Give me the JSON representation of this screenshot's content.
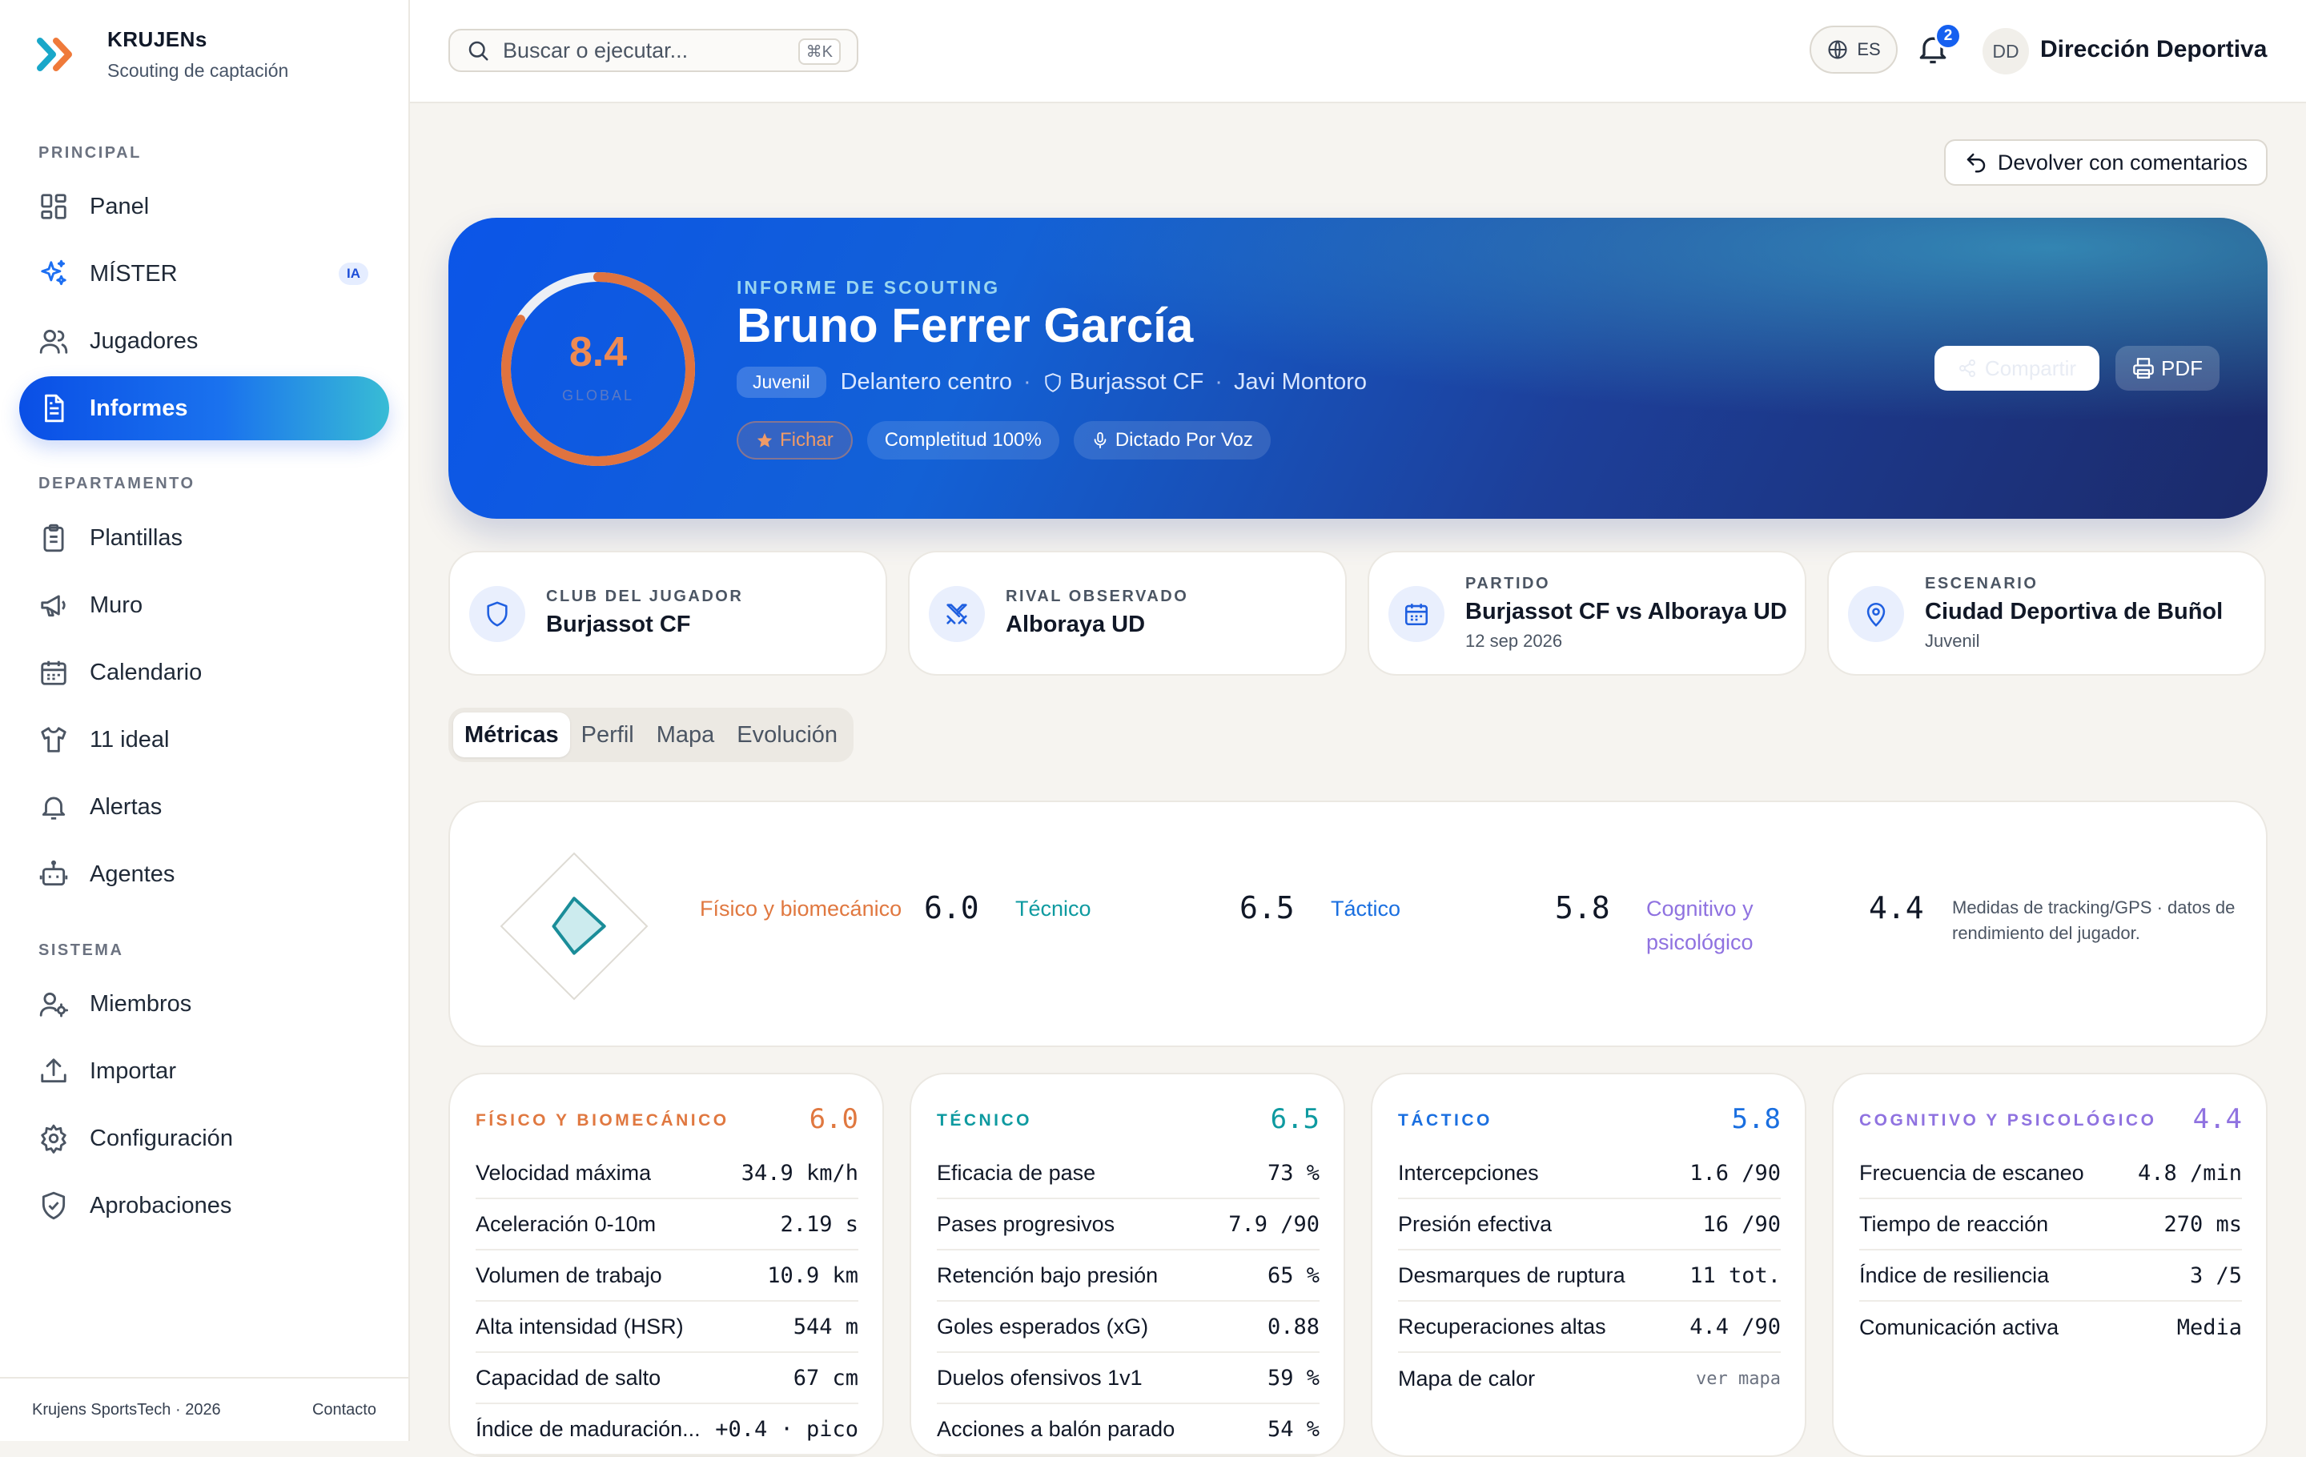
{
  "app": {
    "name": "KRUJENs",
    "subtitle": "Scouting de captación"
  },
  "sidebar": {
    "sections": {
      "principal": "PRINCIPAL",
      "departamento": "DEPARTAMENTO",
      "sistema": "SISTEMA"
    },
    "items": [
      {
        "label": "Panel",
        "icon": "grid-icon"
      },
      {
        "label": "MÍSTER",
        "icon": "sparkles-icon",
        "badge": "IA"
      },
      {
        "label": "Jugadores",
        "icon": "users-icon"
      },
      {
        "label": "Informes",
        "icon": "document-icon",
        "active": true
      },
      {
        "label": "Plantillas",
        "icon": "clipboard-icon"
      },
      {
        "label": "Muro",
        "icon": "megaphone-icon"
      },
      {
        "label": "Calendario",
        "icon": "calendar-icon"
      },
      {
        "label": "11 ideal",
        "icon": "shirt-icon"
      },
      {
        "label": "Alertas",
        "icon": "bell-icon"
      },
      {
        "label": "Agentes",
        "icon": "bot-icon"
      },
      {
        "label": "Miembros",
        "icon": "user-cog-icon"
      },
      {
        "label": "Importar",
        "icon": "upload-icon"
      },
      {
        "label": "Configuración",
        "icon": "gear-icon"
      },
      {
        "label": "Aprobaciones",
        "icon": "shield-check-icon"
      }
    ],
    "footer": {
      "copyright": "Krujens SportsTech · 2026",
      "contact": "Contacto"
    }
  },
  "header": {
    "search_placeholder": "Buscar o ejecutar...",
    "search_shortcut": "⌘K",
    "language": "ES",
    "notifications": "2",
    "avatar_initials": "DD",
    "user": "Dirección Deportiva"
  },
  "actions": {
    "return": "Devolver con comentarios"
  },
  "report": {
    "kicker": "INFORME DE SCOUTING",
    "player": "Bruno Ferrer García",
    "score": "8.4",
    "score_value": 8.4,
    "score_max": 10,
    "score_label": "GLOBAL",
    "category": "Juvenil",
    "position": "Delantero centro",
    "club": "Burjassot CF",
    "scout": "Javi Montoro",
    "tags": {
      "recommendation": "Fichar",
      "completeness": "Completitud 100%",
      "voice": "Dictado Por Voz"
    },
    "share": "Compartir",
    "pdf": "PDF",
    "accent": "#ee8a52"
  },
  "info_cards": [
    {
      "label": "CLUB DEL JUGADOR",
      "value": "Burjassot CF",
      "sub": "",
      "icon": "shield-icon"
    },
    {
      "label": "RIVAL OBSERVADO",
      "value": "Alboraya UD",
      "sub": "",
      "icon": "swords-icon"
    },
    {
      "label": "PARTIDO",
      "value": "Burjassot CF vs Alboraya UD",
      "sub": "12 sep 2026",
      "icon": "calendar-icon"
    },
    {
      "label": "ESCENARIO",
      "value": "Ciudad Deportiva de Buñol",
      "sub": "Juvenil",
      "icon": "map-pin-icon"
    }
  ],
  "tabs": [
    "Métricas",
    "Perfil",
    "Mapa",
    "Evolución"
  ],
  "summary": {
    "categories": [
      {
        "label": "Físico y biomecánico",
        "value": "6.0",
        "color": "#e07840"
      },
      {
        "label": "Técnico",
        "value": "6.5",
        "color": "#0e9aa0"
      },
      {
        "label": "Táctico",
        "value": "5.8",
        "color": "#1a6fe0"
      },
      {
        "label": "Cognitivo y psicológico",
        "value": "4.4",
        "color": "#8f72e0"
      }
    ],
    "note": "Medidas de tracking/GPS · datos de rendimiento del jugador."
  },
  "metrics": [
    {
      "title": "FÍSICO Y BIOMECÁNICO",
      "score": "6.0",
      "color": "#e07840",
      "rows": [
        {
          "label": "Velocidad máxima",
          "value": "34.9 km/h"
        },
        {
          "label": "Aceleración 0-10m",
          "value": "2.19 s"
        },
        {
          "label": "Volumen de trabajo",
          "value": "10.9 km"
        },
        {
          "label": "Alta intensidad (HSR)",
          "value": "544 m"
        },
        {
          "label": "Capacidad de salto",
          "value": "67 cm"
        },
        {
          "label": "Índice de maduración...",
          "value": "+0.4 · pico"
        }
      ]
    },
    {
      "title": "TÉCNICO",
      "score": "6.5",
      "color": "#0e9aa0",
      "rows": [
        {
          "label": "Eficacia de pase",
          "value": "73 %"
        },
        {
          "label": "Pases progresivos",
          "value": "7.9 /90"
        },
        {
          "label": "Retención bajo presión",
          "value": "65 %"
        },
        {
          "label": "Goles esperados (xG)",
          "value": "0.88"
        },
        {
          "label": "Duelos ofensivos 1v1",
          "value": "59 %"
        },
        {
          "label": "Acciones a balón parado",
          "value": "54 %"
        }
      ]
    },
    {
      "title": "TÁCTICO",
      "score": "5.8",
      "color": "#1a6fe0",
      "rows": [
        {
          "label": "Intercepciones",
          "value": "1.6 /90"
        },
        {
          "label": "Presión efectiva",
          "value": "16 /90"
        },
        {
          "label": "Desmarques de ruptura",
          "value": "11 tot."
        },
        {
          "label": "Recuperaciones altas",
          "value": "4.4 /90"
        },
        {
          "label": "Mapa de calor",
          "value": "ver mapa"
        }
      ]
    },
    {
      "title": "COGNITIVO Y PSICOLÓGICO",
      "score": "4.4",
      "color": "#8f72e0",
      "rows": [
        {
          "label": "Frecuencia de escaneo",
          "value": "4.8 /min"
        },
        {
          "label": "Tiempo de reacción",
          "value": "270 ms"
        },
        {
          "label": "Índice de resiliencia",
          "value": "3 /5"
        },
        {
          "label": "Comunicación activa",
          "value": "Media"
        }
      ]
    }
  ]
}
